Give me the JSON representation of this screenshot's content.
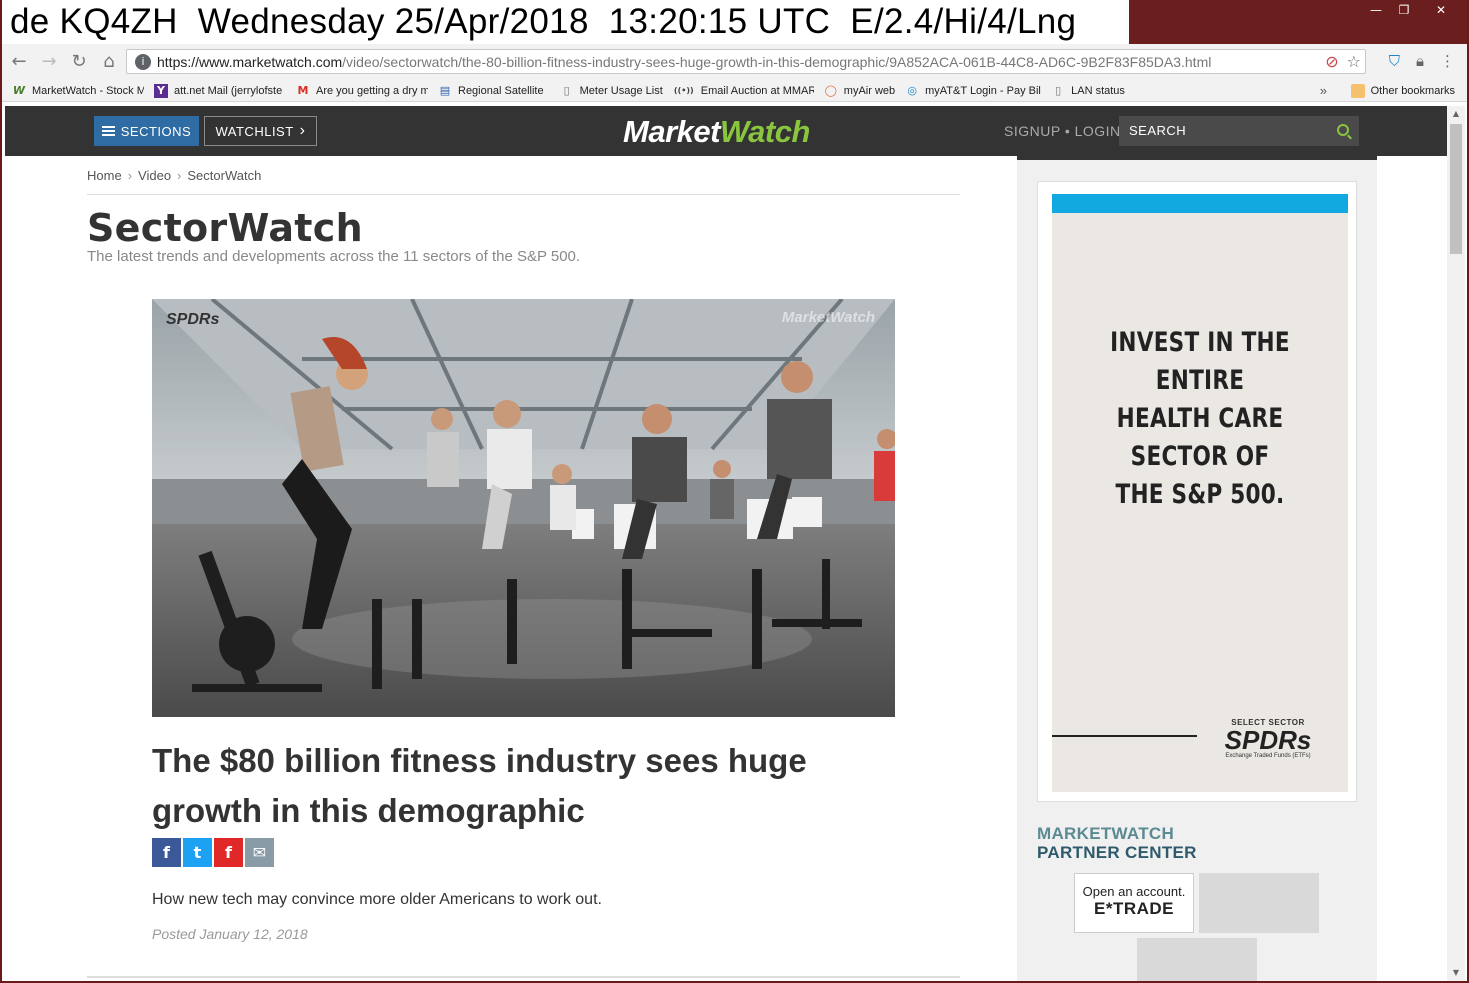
{
  "system_banner": {
    "text": "de KQ4ZH  Wednesday 25/Apr/2018  13:20:15 UTC  E/2.4/Hi/4/Lng"
  },
  "window_controls": {
    "minimize": "—",
    "maximize": "❐",
    "close": "✕"
  },
  "browser": {
    "url_host": "https://www.marketwatch.com",
    "url_path": "/video/sectorwatch/the-80-billion-fitness-industry-sees-huge-growth-in-this-demographic/9A852ACA-061B-44C8-AD6C-9B2F83F85DA3.html",
    "nav_icons": [
      "back-icon",
      "forward-icon",
      "reload-icon",
      "home-icon"
    ],
    "bookmarks": [
      {
        "label": "MarketWatch - Stock M",
        "icon": "W",
        "color": "#4a7c2b"
      },
      {
        "label": "att.net Mail (jerrylofste",
        "icon": "Y",
        "color": "#5b2c91"
      },
      {
        "label": "Are you getting a dry m",
        "icon": "M",
        "color": "#d93025"
      },
      {
        "label": "Regional Satellite",
        "icon": "▤",
        "color": "#2b5ea8"
      },
      {
        "label": "Meter Usage List",
        "icon": "▯",
        "color": "#777777"
      },
      {
        "label": "Email Auction at MMARS",
        "icon": "((•))",
        "color": "#444444"
      },
      {
        "label": "myAir web",
        "icon": "◯",
        "color": "#e0703a"
      },
      {
        "label": "myAT&T Login - Pay Bill",
        "icon": "◎",
        "color": "#1a88cc"
      },
      {
        "label": "LAN status",
        "icon": "▯",
        "color": "#777777"
      }
    ],
    "bookmarks_more": "»",
    "other_bookmarks": "Other bookmarks"
  },
  "header": {
    "sections_label": "SECTIONS",
    "watchlist_label": "WATCHLIST",
    "watchlist_chevron": "›",
    "logo_market": "Market",
    "logo_watch": "Watch",
    "signup_label": "SIGNUP • LOGIN",
    "search_placeholder": "SEARCH"
  },
  "breadcrumb": {
    "items": [
      "Home",
      "Video",
      "SectorWatch"
    ],
    "separator": "›"
  },
  "page": {
    "title": "SectorWatch",
    "subtitle": "The latest trends and developments across the 11 sectors of the S&P 500."
  },
  "video": {
    "watermark_left": "SPDRs",
    "watermark_right": "MarketWatch"
  },
  "article": {
    "title": "The $80 billion fitness industry sees huge growth in this demographic",
    "share": {
      "facebook": "f",
      "twitter": "t",
      "flipboard": "f",
      "email": "✉"
    },
    "description": "How new tech may convince more older Americans to work out.",
    "posted": "Posted January 12, 2018"
  },
  "ad": {
    "headline_lines": [
      "INVEST IN THE ENTIRE",
      "HEALTH CARE SECTOR OF",
      "THE S&P 500."
    ],
    "logo_top": "SELECT SECTOR",
    "logo_main": "SPDRs",
    "logo_bottom": "Exchange Traded Funds (ETFs)",
    "accent_color": "#12a9e0"
  },
  "partner": {
    "heading_line1": "MARKETWATCH",
    "heading_line2": "PARTNER CENTER",
    "etrade_tagline": "Open an account.",
    "etrade_brand": "E*TRADE"
  },
  "colors": {
    "header_bg": "#333333",
    "sections_blue": "#2f6ca3",
    "logo_green": "#8ac540",
    "window_frame": "#6b1e1e"
  }
}
